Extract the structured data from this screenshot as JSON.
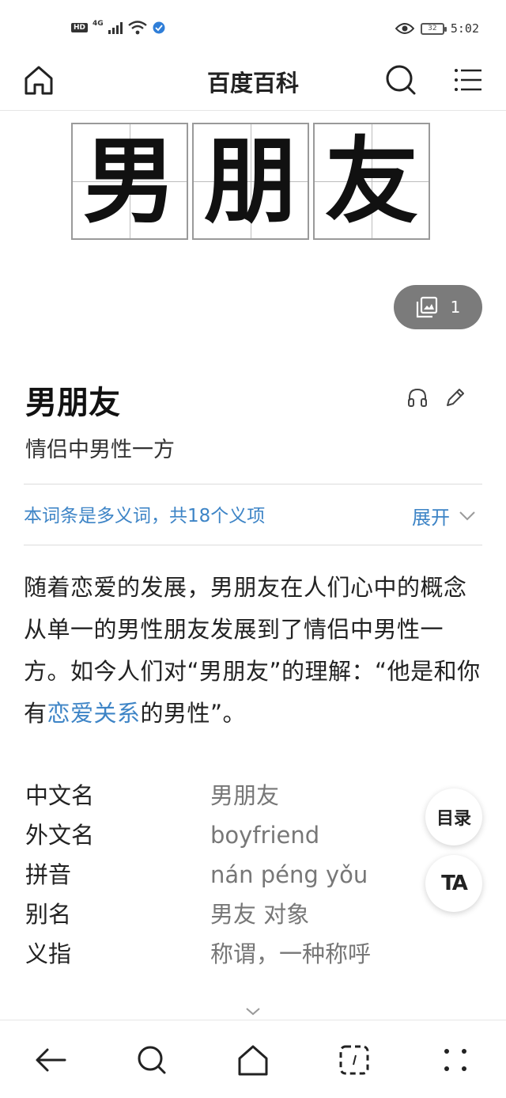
{
  "status_bar": {
    "hd": "HD",
    "network": "4G",
    "battery": "32",
    "time": "5:02"
  },
  "header": {
    "title": "百度百科"
  },
  "hero": {
    "characters": [
      "男",
      "朋",
      "友"
    ]
  },
  "photo_count": "1",
  "entry": {
    "title": "男朋友",
    "subtitle": "情侣中男性一方",
    "polysemy_note": "本词条是多义词，共18个义项",
    "expand_label": "展开"
  },
  "summary": {
    "part1": "随着恋爱的发展，男朋友在人们心中的概念从单一的男性朋友发展到了情侣中男性一方。如今人们对“男朋友”的理解：“他是和你有",
    "link": "恋爱关系",
    "part2": "的男性”。"
  },
  "infobox": [
    {
      "key": "中文名",
      "value": "男朋友"
    },
    {
      "key": "外文名",
      "value": "boyfriend"
    },
    {
      "key": "拼音",
      "value": "nán péng yǒu"
    },
    {
      "key": "别名",
      "value": "男友 对象"
    },
    {
      "key": "义指",
      "value": "称谓，一种称呼"
    }
  ],
  "fab": {
    "toc": "目录",
    "text_size": "TA"
  },
  "colors": {
    "link": "#3d84c6",
    "pill": "#7b7b7b"
  }
}
